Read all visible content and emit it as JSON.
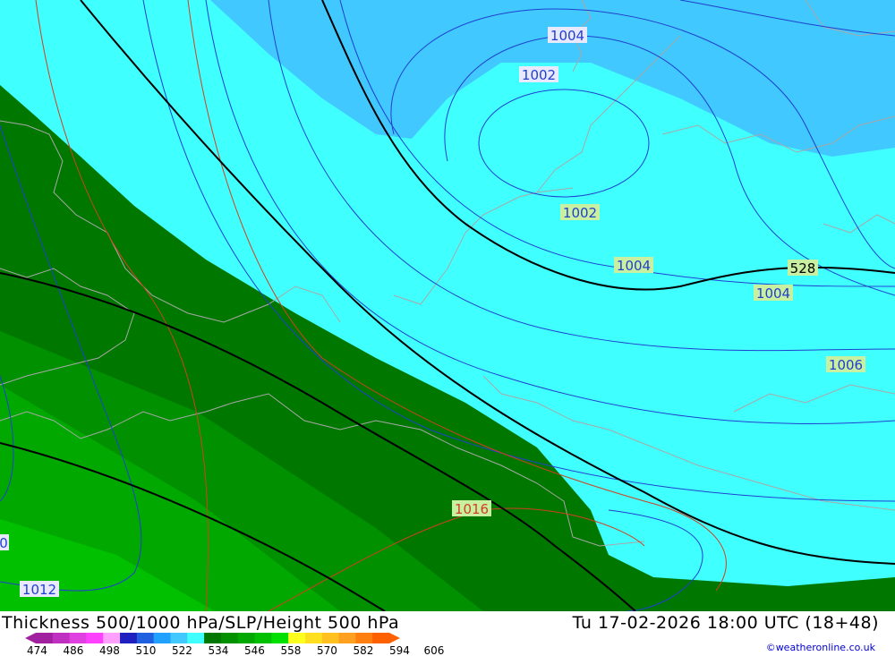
{
  "footer": {
    "title": "Thickness 500/1000 hPa/SLP/Height 500 hPa",
    "datetime": "Tu 17-02-2026 18:00 UTC (18+48)",
    "credit": "©weatheronline.co.uk"
  },
  "legend": {
    "ticks": [
      "474",
      "486",
      "498",
      "510",
      "522",
      "534",
      "546",
      "558",
      "570",
      "582",
      "594",
      "606"
    ],
    "colors": [
      "#a020a0",
      "#c030c0",
      "#e040e0",
      "#ff40ff",
      "#ffa0ff",
      "#2020c0",
      "#2060e0",
      "#20a0ff",
      "#40c8ff",
      "#40ffff",
      "#007800",
      "#009000",
      "#00a800",
      "#00c000",
      "#00e000",
      "#ffff20",
      "#ffe020",
      "#ffc020",
      "#ffa020",
      "#ff8010",
      "#ff6000"
    ]
  },
  "map_labels": {
    "slp_1004_top": "1004",
    "slp_1002_a": "1002",
    "slp_1002_b": "1002",
    "slp_1004_mid": "1004",
    "height_528": "528",
    "slp_1004_right": "1004",
    "slp_1006": "1006",
    "slp_1016": "1016",
    "slp_1012": "1012",
    "slp_0_edge": "0"
  }
}
